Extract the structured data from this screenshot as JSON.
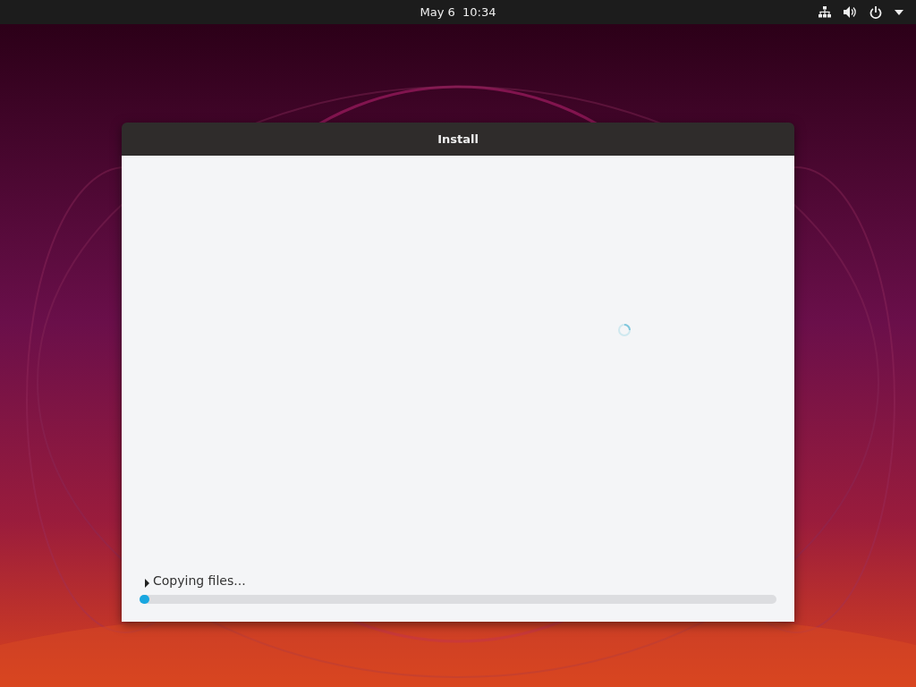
{
  "top_bar": {
    "clock": "May 6  10:34"
  },
  "window": {
    "title": "Install"
  },
  "progress": {
    "label": "Copying files...",
    "expanded": false,
    "level": 0.015
  }
}
